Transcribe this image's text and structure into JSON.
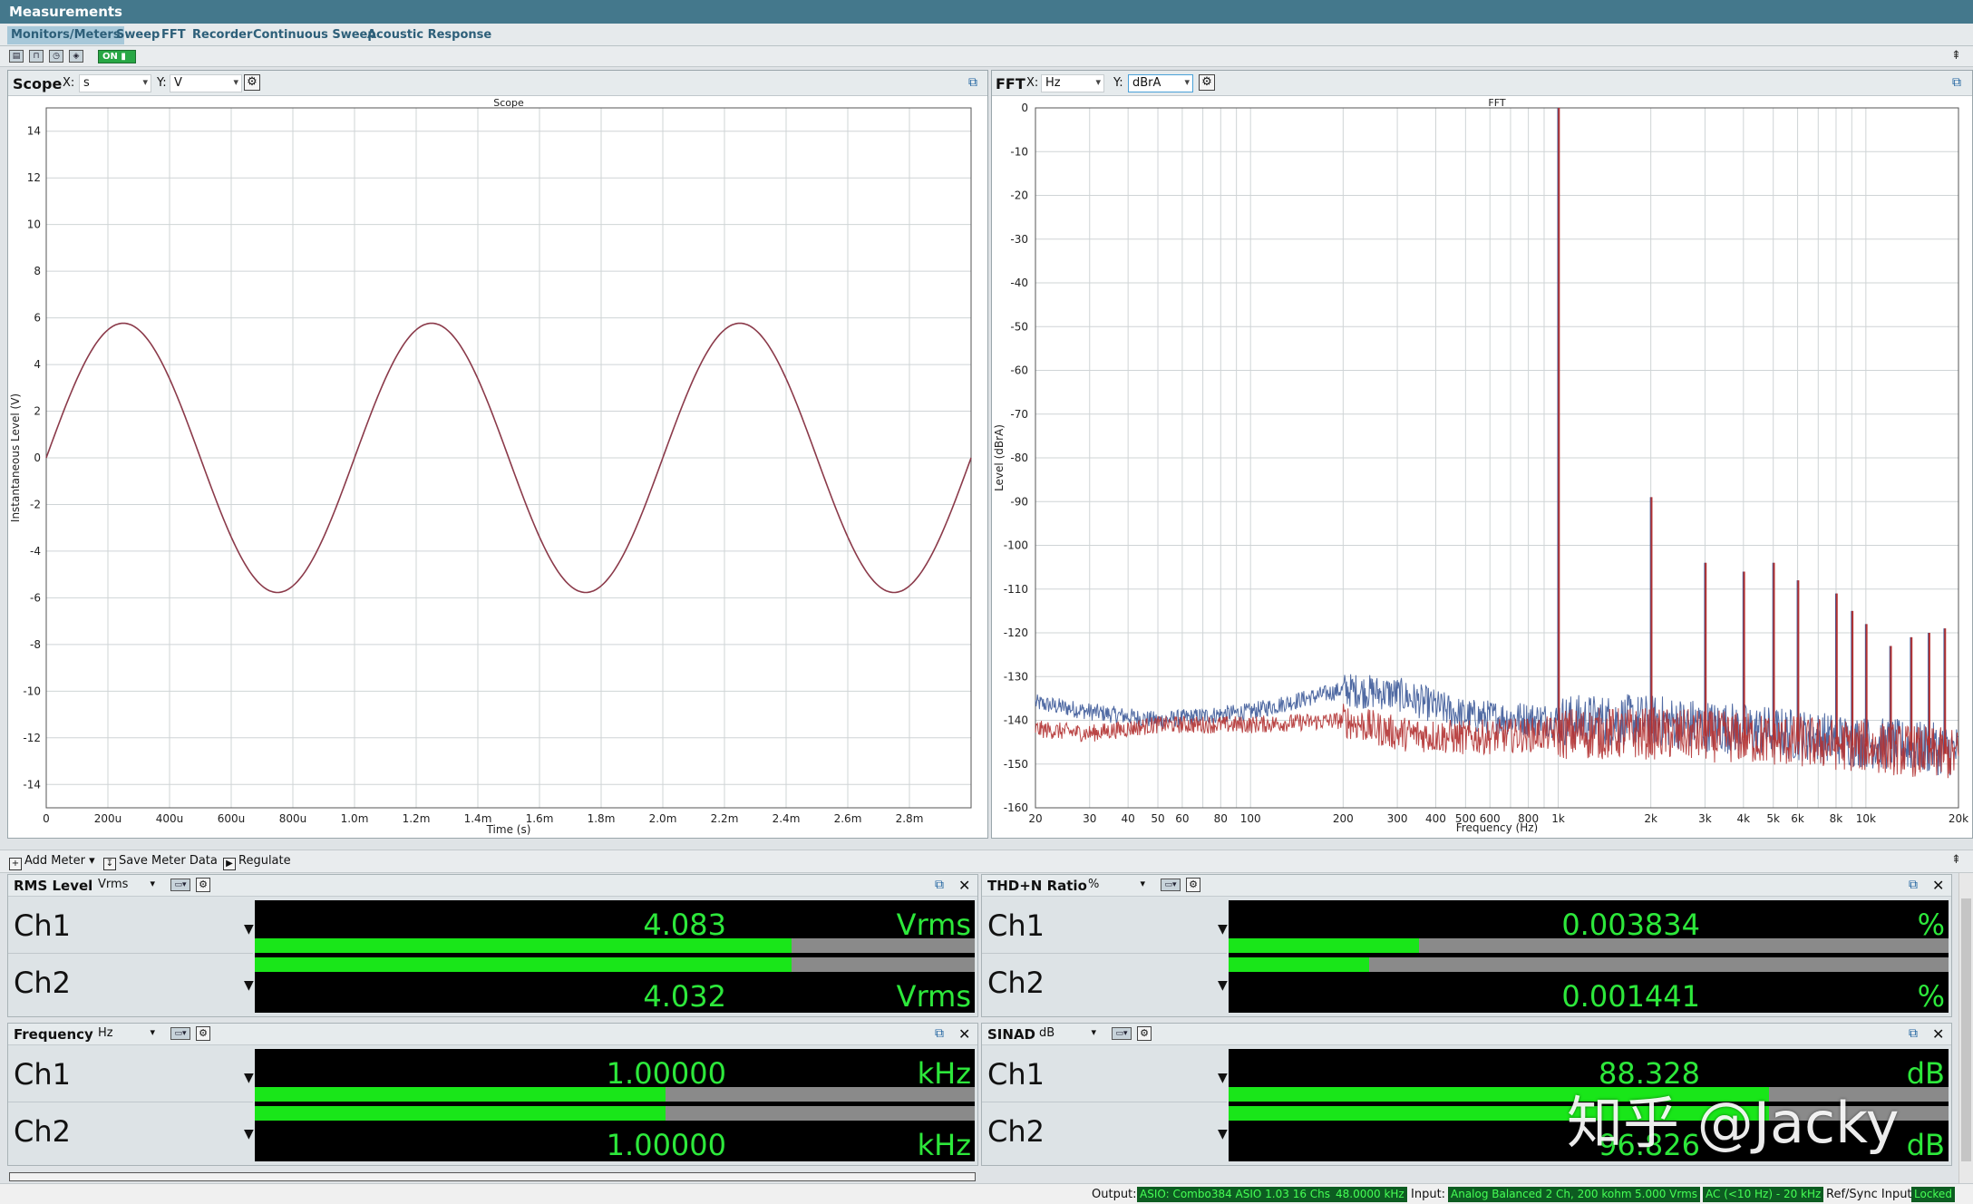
{
  "window": {
    "title": "Measurements"
  },
  "tabs": [
    {
      "label": "Monitors/Meters",
      "active": true
    },
    {
      "label": "Sweep"
    },
    {
      "label": "FFT"
    },
    {
      "label": "Recorder"
    },
    {
      "label": "Continuous Sweep"
    },
    {
      "label": "Acoustic Response"
    }
  ],
  "toolbar": {
    "on_label": "ON"
  },
  "scope": {
    "name": "Scope",
    "x_label": "X:",
    "x_unit": "s",
    "y_label": "Y:",
    "y_unit": "V"
  },
  "fft": {
    "name": "FFT",
    "x_label": "X:",
    "x_unit": "Hz",
    "y_label": "Y:",
    "y_unit": "dBrA"
  },
  "chart_data": [
    {
      "type": "line",
      "title": "Scope",
      "xlabel": "Time (s)",
      "ylabel": "Instantaneous Level (V)",
      "xlim": [
        0,
        0.003
      ],
      "ylim": [
        -15,
        15
      ],
      "x_ticks": [
        0,
        0.0002,
        0.0004,
        0.0006,
        0.0008,
        0.001,
        0.0012,
        0.0014,
        0.0016,
        0.0018,
        0.002,
        0.0022,
        0.0024,
        0.0026,
        0.0028
      ],
      "x_tick_labels": [
        "0",
        "200u",
        "400u",
        "600u",
        "800u",
        "1.0m",
        "1.2m",
        "1.4m",
        "1.6m",
        "1.8m",
        "2.0m",
        "2.2m",
        "2.4m",
        "2.6m",
        "2.8m"
      ],
      "y_ticks": [
        14,
        12,
        10,
        8,
        6,
        4,
        2,
        0,
        -2,
        -4,
        -6,
        -8,
        -10,
        -12,
        -14
      ],
      "grid": true,
      "series": [
        {
          "color": "#8b3a4a",
          "frequency_hz": 1000,
          "amplitude_v": 5.77,
          "phase_deg": 0
        }
      ]
    },
    {
      "type": "line",
      "title": "FFT",
      "xlabel": "Frequency (Hz)",
      "ylabel": "Level (dBrA)",
      "xscale": "log",
      "xlim": [
        20,
        20000
      ],
      "ylim": [
        -160,
        0
      ],
      "x_ticks": [
        20,
        30,
        40,
        50,
        60,
        80,
        100,
        200,
        300,
        400,
        500,
        600,
        800,
        1000,
        2000,
        3000,
        4000,
        5000,
        6000,
        8000,
        10000,
        20000
      ],
      "x_tick_labels": [
        "20",
        "30",
        "40",
        "50",
        "60",
        "80",
        "100",
        "200",
        "300",
        "400",
        "500",
        "600",
        "800",
        "1k",
        "2k",
        "3k",
        "4k",
        "5k",
        "6k",
        "8k",
        "10k",
        "20k"
      ],
      "y_ticks": [
        0,
        -10,
        -20,
        -30,
        -40,
        -50,
        -60,
        -70,
        -80,
        -90,
        -100,
        -110,
        -120,
        -130,
        -140,
        -150,
        -160
      ],
      "grid": true,
      "series": [
        {
          "color": "#3d5a99",
          "noise_floor_points": [
            [
              20,
              -136
            ],
            [
              30,
              -138
            ],
            [
              50,
              -140
            ],
            [
              100,
              -138
            ],
            [
              200,
              -133
            ],
            [
              300,
              -134
            ],
            [
              500,
              -139
            ],
            [
              1000,
              -140
            ],
            [
              2000,
              -140
            ],
            [
              4000,
              -142
            ],
            [
              10000,
              -145
            ],
            [
              20000,
              -147
            ]
          ],
          "peaks": [
            [
              1000,
              0
            ],
            [
              2000,
              -89
            ],
            [
              3000,
              -104
            ],
            [
              4000,
              -106
            ],
            [
              5000,
              -104
            ],
            [
              6000,
              -108
            ],
            [
              8000,
              -111
            ],
            [
              9000,
              -115
            ],
            [
              10000,
              -118
            ],
            [
              12000,
              -123
            ],
            [
              14000,
              -121
            ],
            [
              16000,
              -120
            ],
            [
              18000,
              -119
            ]
          ]
        },
        {
          "color": "#b33232",
          "noise_floor_points": [
            [
              20,
              -142
            ],
            [
              30,
              -143
            ],
            [
              50,
              -141
            ],
            [
              100,
              -141
            ],
            [
              200,
              -140
            ],
            [
              300,
              -143
            ],
            [
              500,
              -144
            ],
            [
              1000,
              -143
            ],
            [
              2000,
              -143
            ],
            [
              4000,
              -144
            ],
            [
              10000,
              -146
            ],
            [
              20000,
              -148
            ]
          ],
          "peaks": [
            [
              1000,
              0
            ],
            [
              2000,
              -89
            ],
            [
              3000,
              -104
            ],
            [
              4000,
              -106
            ],
            [
              5000,
              -104
            ],
            [
              6000,
              -108
            ],
            [
              8000,
              -111
            ],
            [
              9000,
              -115
            ],
            [
              10000,
              -118
            ],
            [
              12000,
              -123
            ],
            [
              14000,
              -121
            ],
            [
              16000,
              -120
            ],
            [
              18000,
              -119
            ]
          ]
        }
      ]
    }
  ],
  "meter_toolbar": {
    "add_meter": "Add Meter",
    "save_meter_data": "Save Meter Data",
    "regulate": "Regulate"
  },
  "meters": [
    {
      "title": "RMS Level",
      "unit_select": "Vrms",
      "channels": [
        {
          "label": "Ch1",
          "value": "4.083",
          "unit": "Vrms",
          "fill": 0.745
        },
        {
          "label": "Ch2",
          "value": "4.032",
          "unit": "Vrms",
          "fill": 0.745
        }
      ]
    },
    {
      "title": "THD+N Ratio",
      "unit_select": "%",
      "channels": [
        {
          "label": "Ch1",
          "value": "0.003834",
          "unit": "%",
          "fill": 0.265
        },
        {
          "label": "Ch2",
          "value": "0.001441",
          "unit": "%",
          "fill": 0.195
        }
      ]
    },
    {
      "title": "Frequency",
      "unit_select": "Hz",
      "channels": [
        {
          "label": "Ch1",
          "value": "1.00000",
          "unit": "kHz",
          "fill": 0.57
        },
        {
          "label": "Ch2",
          "value": "1.00000",
          "unit": "kHz",
          "fill": 0.57
        }
      ]
    },
    {
      "title": "SINAD",
      "unit_select": "dB",
      "channels": [
        {
          "label": "Ch1",
          "value": "88.328",
          "unit": "dB",
          "fill": 0.75
        },
        {
          "label": "Ch2",
          "value": "96.826",
          "unit": "dB",
          "fill": 0.75
        }
      ]
    }
  ],
  "status": {
    "output_label": "Output:",
    "output_device": "ASIO: Combo384 ASIO 1.03 16 Chs",
    "output_rate": "48.0000 kHz",
    "input_label": "Input:",
    "input_device": "Analog Balanced 2 Ch, 200 kohm",
    "input_range": "5.000 Vrms",
    "input_filter": "AC (<10 Hz) - 20 kHz",
    "refsync_label": "Ref/Sync Input:",
    "refsync_state": "Locked"
  },
  "watermark": "知乎 @Jacky",
  "colors": {
    "titlebar": "#44788c",
    "readout_text": "#2de83b",
    "bar_fill": "#19e619"
  }
}
